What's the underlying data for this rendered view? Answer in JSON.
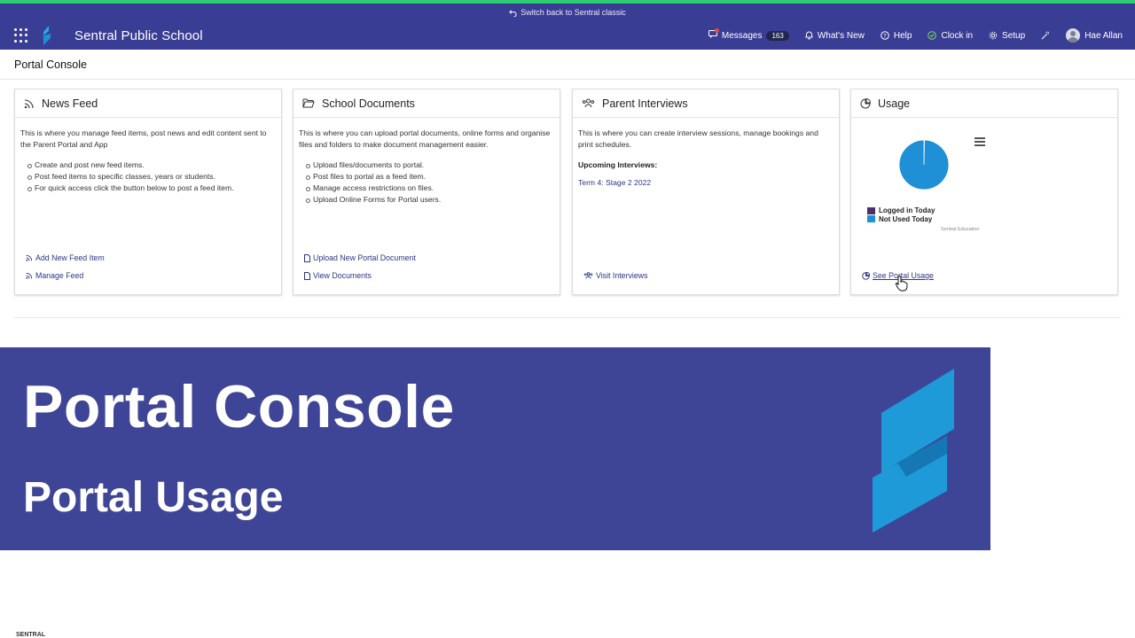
{
  "classic_bar": {
    "label": "Switch back to Sentral classic"
  },
  "navbar": {
    "school_name": "Sentral Public School",
    "messages_label": "Messages",
    "messages_count": "163",
    "whats_new": "What's New",
    "help": "Help",
    "clock_in": "Clock in",
    "setup": "Setup",
    "user_name": "Hae Allan"
  },
  "page": {
    "title": "Portal Console"
  },
  "cards": {
    "news": {
      "title": "News Feed",
      "desc": "This is where you manage feed items, post news and edit content sent to the Parent Portal and App",
      "bullets": [
        "Create and post new feed items.",
        "Post feed items to specific classes, years or students.",
        "For quick access click the button below to post a feed item."
      ],
      "link1": "Add New Feed Item",
      "link2": "Manage Feed"
    },
    "docs": {
      "title": "School Documents",
      "desc": "This is where you can upload portal documents, online forms and organise files and folders to make document management easier.",
      "bullets": [
        "Upload files/documents to portal.",
        "Post files to portal as a feed item.",
        "Manage access restrictions on files.",
        "Upload Online Forms for Portal users."
      ],
      "link1": "Upload New Portal Document",
      "link2": "View Documents"
    },
    "interviews": {
      "title": "Parent Interviews",
      "desc": "This is where you can create interview sessions, manage bookings and print schedules.",
      "upcoming_label": "Upcoming Interviews:",
      "upcoming_item": "Term 4: Stage 2 2022",
      "link": "Visit Interviews"
    },
    "usage": {
      "title": "Usage",
      "legend": [
        "Logged in Today",
        "Not Used Today"
      ],
      "credit": "Sentral Education",
      "link": "See Portal Usage"
    }
  },
  "chart_data": {
    "type": "pie",
    "categories": [
      "Logged in Today",
      "Not Used Today"
    ],
    "values": [
      0.3,
      99.7
    ],
    "colors": [
      "#4b2f6b",
      "#1f8fd6"
    ],
    "legend": "bottom-left"
  },
  "banner": {
    "title": "Portal Console",
    "subtitle": "Portal Usage"
  },
  "colors": {
    "navbar": "#3a3d94",
    "banner": "#3f4596",
    "accent": "#1f8fd6",
    "topline": "#2ecc71"
  },
  "footer": {
    "brand": "SENTRAL"
  }
}
